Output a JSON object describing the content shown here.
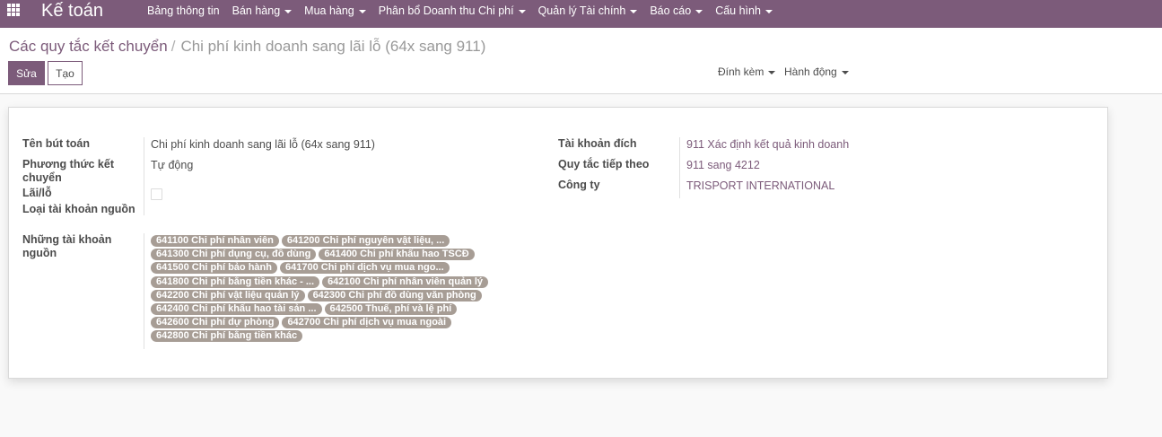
{
  "navbar": {
    "app_title": "Kế toán",
    "menu": [
      {
        "label": "Bảng thông tin",
        "has_dropdown": false
      },
      {
        "label": "Bán hàng",
        "has_dropdown": true
      },
      {
        "label": "Mua hàng",
        "has_dropdown": true
      },
      {
        "label": "Phân bổ Doanh thu Chi phí",
        "has_dropdown": true
      },
      {
        "label": "Quản lý Tài chính",
        "has_dropdown": true
      },
      {
        "label": "Báo cáo",
        "has_dropdown": true
      },
      {
        "label": "Cấu hình",
        "has_dropdown": true
      }
    ]
  },
  "breadcrumb": {
    "parent": "Các quy tắc kết chuyển",
    "separator": "/",
    "current": "Chi phí kinh doanh sang lãi lỗ (64x sang 911)"
  },
  "toolbar": {
    "edit_label": "Sửa",
    "create_label": "Tạo",
    "attach_label": "Đính kèm",
    "action_label": "Hành động"
  },
  "form": {
    "entry_name_label": "Tên bút toán",
    "entry_name_value": "Chi phí kinh doanh sang lãi lỗ (64x sang 911)",
    "method_label_line1": "Phương thức kết",
    "method_label_line2": "chuyển",
    "method_value": "Tự động",
    "profit_loss_label": "Lãi/lỗ",
    "profit_loss_checked": false,
    "source_type_label": "Loại tài khoản nguồn",
    "target_account_label": "Tài khoản đích",
    "target_account_value": "911 Xác định kết quả kinh doanh",
    "next_rule_label": "Quy tắc tiếp theo",
    "next_rule_value": "911 sang 4212",
    "company_label": "Công ty",
    "company_value": "TRISPORT INTERNATIONAL",
    "source_accounts_label_line1": "Những tài khoản",
    "source_accounts_label_line2": "nguồn",
    "source_accounts": [
      [
        "641100 Chi phí nhân viên",
        "641200 Chi phí nguyên vật liệu, ..."
      ],
      [
        "641300 Chi phí dụng cụ, đồ dùng",
        "641400 Chi phí khấu hao TSCĐ"
      ],
      [
        "641500 Chi phí bảo hành",
        "641700 Chi phí dịch vụ mua ngo..."
      ],
      [
        "641800 Chi phí bằng tiền khác - ...",
        "642100 Chi phí nhân viên quản lý"
      ],
      [
        "642200 Chi phí vật liệu quản lý",
        "642300 Chi phí đồ dùng văn phòng"
      ],
      [
        "642400 Chi phí khấu hao tài sản ...",
        "642500 Thuế, phí và lệ phí"
      ],
      [
        "642600 Chi phí dự phòng",
        "642700 Chi phí dịch vụ mua ngoài"
      ],
      [
        "642800 Chi phí bằng tiền khác"
      ]
    ]
  },
  "colors": {
    "brand": "#7c5b7a",
    "tag": "#a79d95"
  }
}
